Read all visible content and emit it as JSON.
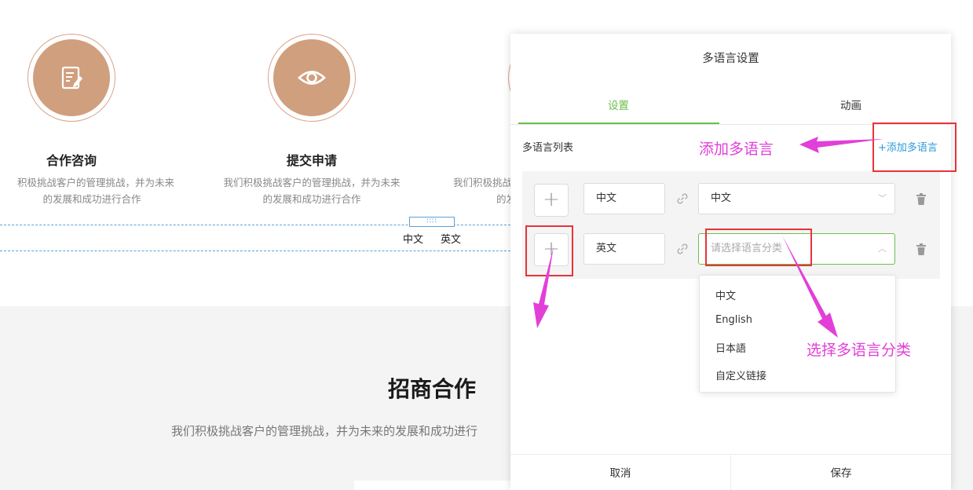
{
  "background": {
    "cards": [
      {
        "title": "合作咨询",
        "desc_line1": "积极挑战客户的管理挑战，并为未来",
        "desc_line2": "的发展和成功进行合作",
        "icon": "edit-document-icon"
      },
      {
        "title": "提交申请",
        "desc_line1": "我们积极挑战客户的管理挑战，并为未来",
        "desc_line2": "的发展和成功进行合作",
        "icon": "eye-icon"
      },
      {
        "title": "",
        "desc_line1": "我们积极挑战",
        "desc_line2": "的发",
        "icon": ""
      }
    ],
    "drag_handle": "∷∷",
    "lang_links": [
      "中文",
      "英文"
    ],
    "section_title": "招商合作",
    "section_desc": "我们积极挑战客户的管理挑战，并为未来的发展和成功进行"
  },
  "panel": {
    "title": "多语言设置",
    "tabs": [
      {
        "label": "设置",
        "active": true
      },
      {
        "label": "动画",
        "active": false
      }
    ],
    "list_label": "多语言列表",
    "add_label": "+添加多语言",
    "rows": [
      {
        "name": "中文",
        "select_value": "中文",
        "select_placeholder": ""
      },
      {
        "name": "英文",
        "select_value": "",
        "select_placeholder": "请选择语言分类"
      }
    ],
    "dropdown_options": [
      "中文",
      "English",
      "日本語",
      "自定义链接"
    ],
    "cancel_label": "取消",
    "save_label": "保存"
  },
  "annotations": {
    "add_note": "添加多语言",
    "select_note": "选择多语言分类"
  },
  "colors": {
    "accent_green": "#6abf4b",
    "link_blue": "#2e9bd8",
    "circle_brown": "#d09f7e",
    "annotation_red": "#e8333a",
    "annotation_magenta": "#e23fd9"
  }
}
